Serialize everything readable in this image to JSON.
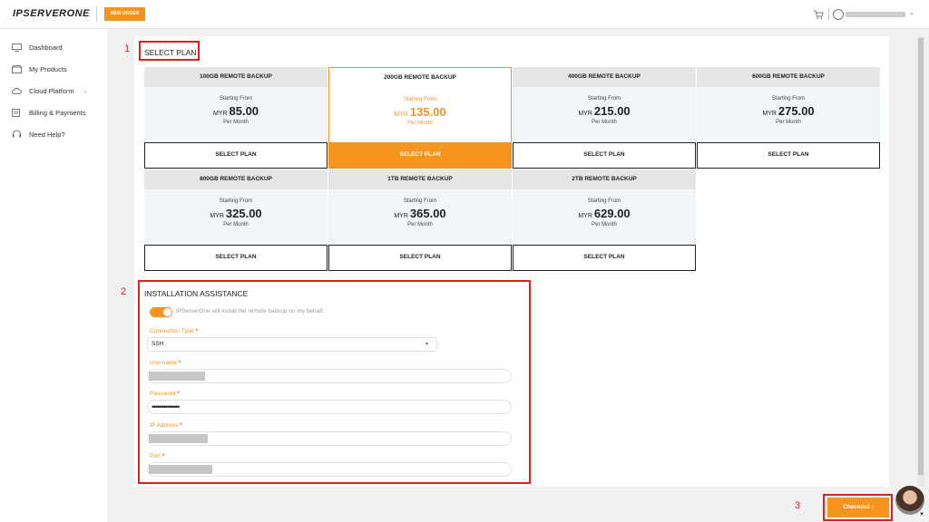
{
  "header": {
    "logo": "IPSERVERONE",
    "new_order": "NEW ORDER",
    "cart_icon": "cart-icon",
    "user_icon": "user-icon",
    "user_chevron": "⌄"
  },
  "sidebar": {
    "items": [
      {
        "label": "Dashboard",
        "icon": "monitor-icon"
      },
      {
        "label": "My Products",
        "icon": "box-icon"
      },
      {
        "label": "Cloud Platform",
        "icon": "cloud-icon",
        "chevron": "⌄"
      },
      {
        "label": "Billing & Payments",
        "icon": "billing-icon"
      },
      {
        "label": "Need Help?",
        "icon": "headset-icon"
      }
    ]
  },
  "annotations": {
    "n1": "1",
    "n2": "2",
    "n3": "3"
  },
  "select_plan": {
    "title": "SELECT PLAN",
    "plans": [
      {
        "name": "100GB REMOTE BACKUP",
        "starting": "Starting From",
        "currency": "MYR",
        "price": "85.00",
        "period": "Per Month",
        "button": "SELECT PLAN",
        "selected": false
      },
      {
        "name": "200GB REMOTE BACKUP",
        "starting": "Starting From",
        "currency": "MYR",
        "price": "135.00",
        "period": "Per Month",
        "button": "SELECT PLAN",
        "selected": true
      },
      {
        "name": "400GB REMOTE BACKUP",
        "starting": "Starting From",
        "currency": "MYR",
        "price": "215.00",
        "period": "Per Month",
        "button": "SELECT PLAN",
        "selected": false
      },
      {
        "name": "600GB REMOTE BACKUP",
        "starting": "Starting From",
        "currency": "MYR",
        "price": "275.00",
        "period": "Per Month",
        "button": "SELECT PLAN",
        "selected": false
      },
      {
        "name": "800GB REMOTE BACKUP",
        "starting": "Starting From",
        "currency": "MYR",
        "price": "325.00",
        "period": "Per Month",
        "button": "SELECT PLAN",
        "selected": false
      },
      {
        "name": "1TB REMOTE BACKUP",
        "starting": "Starting From",
        "currency": "MYR",
        "price": "365.00",
        "period": "Per Month",
        "button": "SELECT PLAN",
        "selected": false
      },
      {
        "name": "2TB REMOTE BACKUP",
        "starting": "Starting From",
        "currency": "MYR",
        "price": "629.00",
        "period": "Per Month",
        "button": "SELECT PLAN",
        "selected": false
      }
    ]
  },
  "installation": {
    "title": "INSTALLATION ASSISTANCE",
    "toggle_on": true,
    "toggle_text": "IPServerOne will install the remote backup on my behalf.",
    "connection_type_label": "Connection Type",
    "connection_type_value": "SSH",
    "username_label": "Username",
    "password_label": "Password",
    "password_value": "••••••••••••••",
    "ip_label": "IP Address",
    "port_label": "Port",
    "required_mark": "*",
    "select_arrow": "▼"
  },
  "checkout": {
    "label": "Checkout",
    "arrow": "›"
  },
  "colors": {
    "accent": "#f7941d",
    "annotation": "#e0201d"
  }
}
